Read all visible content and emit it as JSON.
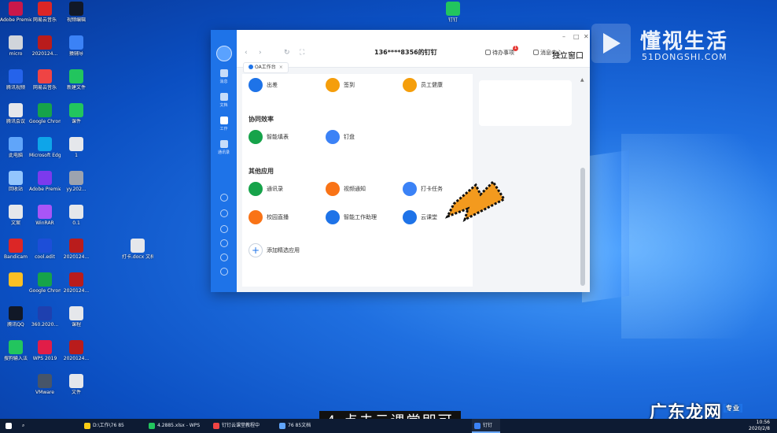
{
  "desktop": {
    "icons_col1": [
      {
        "label": "Adobe Premier...",
        "color": "#c9184a"
      },
      {
        "label": "micro",
        "color": "#d1d5db"
      },
      {
        "label": "腾讯视频",
        "color": "#2563eb"
      },
      {
        "label": "腾讯会议",
        "color": "#e5e7eb"
      },
      {
        "label": "此电脑",
        "color": "#60a5fa"
      },
      {
        "label": "回收站",
        "color": "#93c5fd"
      },
      {
        "label": "文案",
        "color": "#e5e7eb"
      },
      {
        "label": "Bandicam",
        "color": "#dc2626"
      },
      {
        "label": "",
        "color": "#fbbf24"
      },
      {
        "label": "腾讯QQ",
        "color": "#111827"
      },
      {
        "label": "搜狗输入法",
        "color": "#22c55e"
      }
    ],
    "icons_col2": [
      {
        "label": "网易云音乐",
        "color": "#dc2626"
      },
      {
        "label": "2020124...",
        "color": "#b91c1c"
      },
      {
        "label": "网易云音乐",
        "color": "#ef4444"
      },
      {
        "label": "Google Chrome",
        "color": "#16a34a"
      },
      {
        "label": "Microsoft Edge",
        "color": "#0ea5e9"
      },
      {
        "label": "Adobe Premier...",
        "color": "#7c3aed"
      },
      {
        "label": "WinRAR",
        "color": "#a855f7"
      },
      {
        "label": "cool.edit",
        "color": "#1d4ed8"
      },
      {
        "label": "Google Chrome",
        "color": "#16a34a"
      },
      {
        "label": "360.2020...",
        "color": "#1e40af"
      },
      {
        "label": "WPS 2019",
        "color": "#e11d48"
      },
      {
        "label": "VMware",
        "color": "#475569"
      }
    ],
    "icons_col3": [
      {
        "label": "视频编辑",
        "color": "#111827"
      },
      {
        "label": "猿辅导",
        "color": "#3b82f6"
      },
      {
        "label": "新建文件",
        "color": "#22c55e"
      },
      {
        "label": "课件",
        "color": "#22c55e"
      },
      {
        "label": "1",
        "color": "#e5e7eb"
      },
      {
        "label": "yy.202...",
        "color": "#9ca3af"
      },
      {
        "label": "0.1",
        "color": "#e5e7eb"
      },
      {
        "label": "2020124...",
        "color": "#b91c1c"
      },
      {
        "label": "2020124...",
        "color": "#b91c1c"
      },
      {
        "label": "课程",
        "color": "#e5e7eb"
      },
      {
        "label": "2020124...",
        "color": "#b91c1c"
      },
      {
        "label": "文件",
        "color": "#e5e7eb"
      }
    ],
    "extra_icon": {
      "label": "打卡.docx 文档",
      "color": "#e5e7eb"
    },
    "top_icon": {
      "label": "钉钉",
      "color": "#22c55e"
    }
  },
  "brand": {
    "title": "懂视生活",
    "subtitle": "51DONGSHI.COM"
  },
  "app": {
    "rail": [
      {
        "label": "消息"
      },
      {
        "label": "文档"
      },
      {
        "label": "工作"
      },
      {
        "label": "通讯录"
      }
    ],
    "titlebar": {
      "account": "136****8356的钉钉",
      "todo": "待办事项",
      "todo_badge": "1",
      "workbench": "消息中心",
      "mini": "独立窗口"
    },
    "tab": {
      "label": "OA工作台",
      "close": "×"
    },
    "sections": [
      {
        "title": "",
        "tiles": [
          {
            "label": "出差",
            "color": "#1e73e8"
          },
          {
            "label": "签到",
            "color": "#f59e0b"
          },
          {
            "label": "员工健康",
            "color": "#f59e0b"
          }
        ]
      },
      {
        "title": "协同效率",
        "tiles": [
          {
            "label": "智能填表",
            "color": "#16a34a"
          },
          {
            "label": "钉盘",
            "color": "#3b82f6"
          }
        ]
      },
      {
        "title": "其他应用",
        "tiles": [
          {
            "label": "通讯录",
            "color": "#16a34a"
          },
          {
            "label": "视频通知",
            "color": "#f97316"
          },
          {
            "label": "打卡任务",
            "color": "#3b82f6"
          },
          {
            "label": "校园直播",
            "color": "#f97316"
          },
          {
            "label": "智能工作助理",
            "color": "#1e73e8"
          },
          {
            "label": "云课堂",
            "color": "#1e73e8"
          }
        ]
      }
    ],
    "add_tile": {
      "label": "添加精选应用",
      "symbol": "+"
    }
  },
  "caption": "4.点击云课堂即可",
  "watermark2": {
    "text": "广东龙网",
    "tag": "专业"
  },
  "taskbar": {
    "items": [
      {
        "label": "D:\\工作\\76 85",
        "color": "#facc15"
      },
      {
        "label": "4.2885.xlsx - WPS",
        "color": "#22c55e"
      },
      {
        "label": "钉钉云课堂教程中",
        "color": "#ef4444"
      },
      {
        "label": "76 85文档",
        "color": "#60a5fa"
      },
      {
        "label": "钉钉",
        "color": "#3b82f6"
      }
    ],
    "time": "10:56",
    "date": "2020/2/8"
  }
}
